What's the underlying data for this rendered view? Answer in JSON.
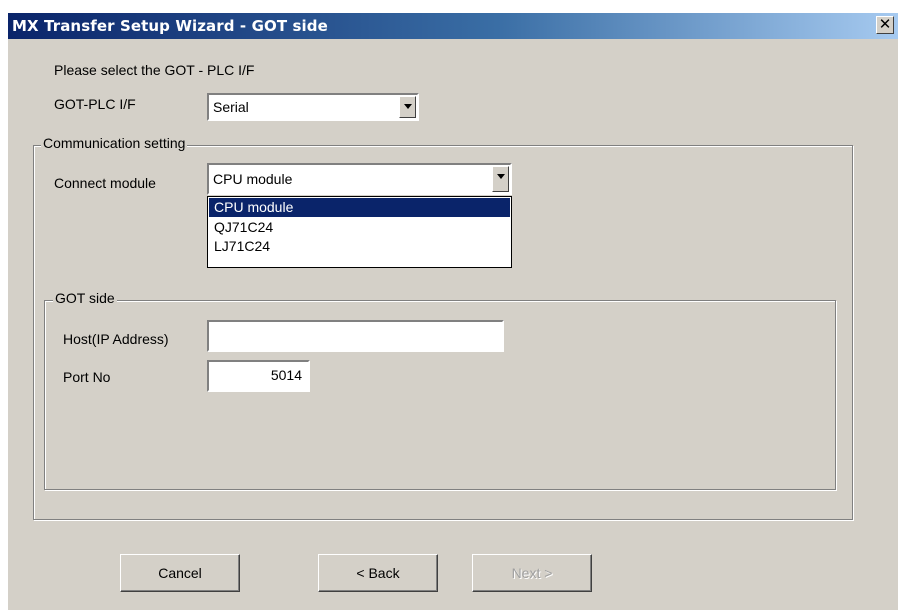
{
  "window": {
    "title": "MX Transfer Setup Wizard - GOT side",
    "close_glyph": "✕"
  },
  "interface": {
    "prompt": "Please select the GOT - PLC I/F",
    "label": "GOT-PLC I/F",
    "selected": "Serial"
  },
  "communication": {
    "group_title": "Communication setting",
    "connect_module_label": "Connect module",
    "connect_module_selected": "CPU module",
    "options": [
      "CPU module",
      "QJ71C24",
      "LJ71C24"
    ]
  },
  "got_side": {
    "group_title": "GOT side",
    "host_label": "Host(IP Address)",
    "host_value": "",
    "port_label": "Port No",
    "port_value": "5014"
  },
  "buttons": {
    "cancel": "Cancel",
    "back": "< Back",
    "next": "Next >"
  },
  "colors": {
    "face": "#d4d0c8",
    "title_gradient_start": "#0a246a",
    "title_gradient_end": "#a6caf0",
    "selection": "#0a246a"
  }
}
